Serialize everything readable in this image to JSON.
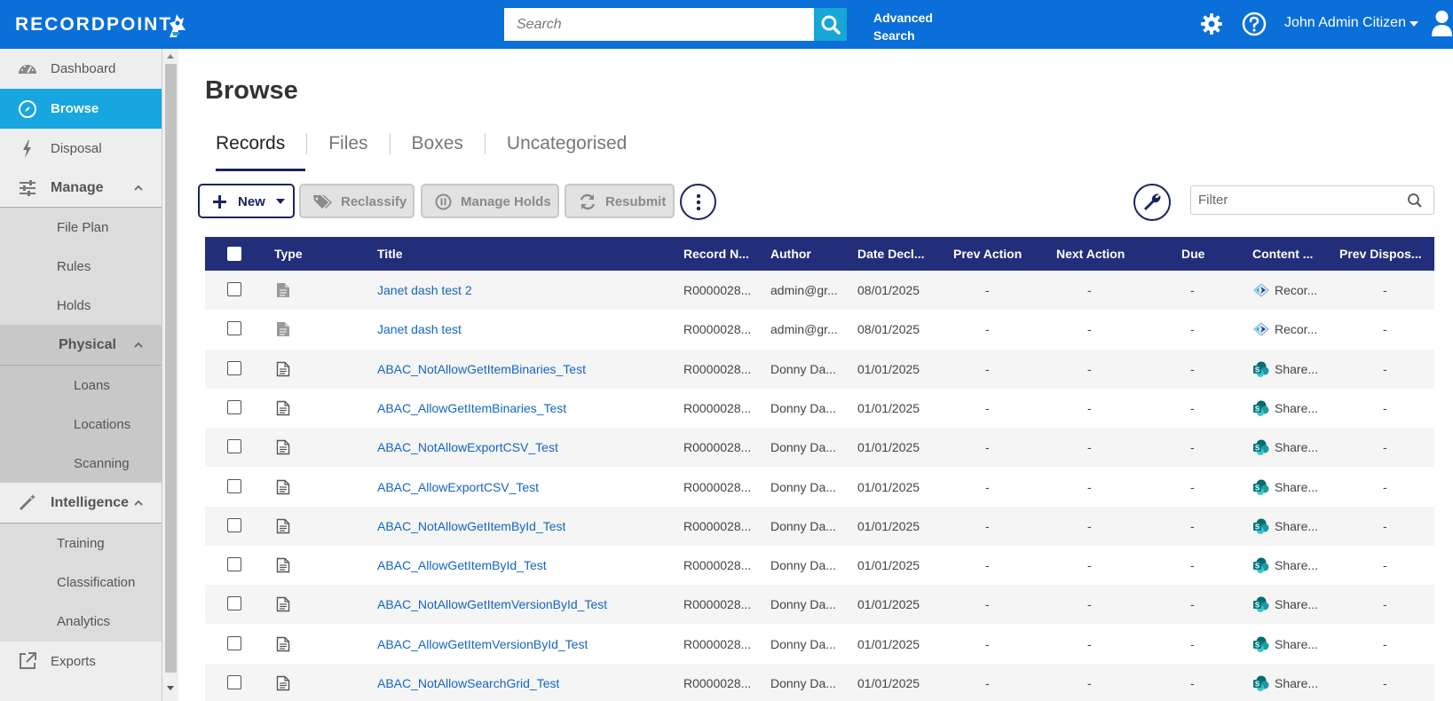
{
  "header": {
    "logo_text": "RECORDPOINT",
    "search_placeholder": "Search",
    "advanced_search_line1": "Advanced",
    "advanced_search_line2": "Search",
    "user_name": "John Admin Citizen"
  },
  "sidebar": {
    "dashboard": "Dashboard",
    "browse": "Browse",
    "disposal": "Disposal",
    "manage": "Manage",
    "file_plan": "File Plan",
    "rules": "Rules",
    "holds": "Holds",
    "physical": "Physical",
    "loans": "Loans",
    "locations": "Locations",
    "scanning": "Scanning",
    "intelligence": "Intelligence",
    "training": "Training",
    "classification": "Classification",
    "analytics": "Analytics",
    "exports": "Exports"
  },
  "main": {
    "title": "Browse",
    "tabs": [
      "Records",
      "Files",
      "Boxes",
      "Uncategorised"
    ],
    "active_tab": "Records",
    "toolbar": {
      "new": "New",
      "reclassify": "Reclassify",
      "manage_holds": "Manage Holds",
      "resubmit": "Resubmit"
    },
    "filter_placeholder": "Filter"
  },
  "table": {
    "columns": [
      "Type",
      "Title",
      "Record N...",
      "Author",
      "Date Decl...",
      "Prev Action",
      "Next Action",
      "Due",
      "Content ...",
      "Prev Dispos..."
    ],
    "rows": [
      {
        "title": "Janet dash test 2",
        "record": "R0000028...",
        "author": "admin@gr...",
        "date": "08/01/2025",
        "prev": "-",
        "next": "-",
        "due": "-",
        "content": "Recor...",
        "content_type": "recordpoint",
        "prevdisp": "-",
        "doc_type": "filled"
      },
      {
        "title": "Janet dash test",
        "record": "R0000028...",
        "author": "admin@gr...",
        "date": "08/01/2025",
        "prev": "-",
        "next": "-",
        "due": "-",
        "content": "Recor...",
        "content_type": "recordpoint",
        "prevdisp": "-",
        "doc_type": "filled"
      },
      {
        "title": "ABAC_NotAllowGetItemBinaries_Test",
        "record": "R0000028...",
        "author": "Donny Da...",
        "date": "01/01/2025",
        "prev": "-",
        "next": "-",
        "due": "-",
        "content": "Share...",
        "content_type": "sharepoint",
        "prevdisp": "-",
        "doc_type": "outline"
      },
      {
        "title": "ABAC_AllowGetItemBinaries_Test",
        "record": "R0000028...",
        "author": "Donny Da...",
        "date": "01/01/2025",
        "prev": "-",
        "next": "-",
        "due": "-",
        "content": "Share...",
        "content_type": "sharepoint",
        "prevdisp": "-",
        "doc_type": "outline"
      },
      {
        "title": "ABAC_NotAllowExportCSV_Test",
        "record": "R0000028...",
        "author": "Donny Da...",
        "date": "01/01/2025",
        "prev": "-",
        "next": "-",
        "due": "-",
        "content": "Share...",
        "content_type": "sharepoint",
        "prevdisp": "-",
        "doc_type": "outline"
      },
      {
        "title": "ABAC_AllowExportCSV_Test",
        "record": "R0000028...",
        "author": "Donny Da...",
        "date": "01/01/2025",
        "prev": "-",
        "next": "-",
        "due": "-",
        "content": "Share...",
        "content_type": "sharepoint",
        "prevdisp": "-",
        "doc_type": "outline"
      },
      {
        "title": "ABAC_NotAllowGetItemById_Test",
        "record": "R0000028...",
        "author": "Donny Da...",
        "date": "01/01/2025",
        "prev": "-",
        "next": "-",
        "due": "-",
        "content": "Share...",
        "content_type": "sharepoint",
        "prevdisp": "-",
        "doc_type": "outline"
      },
      {
        "title": "ABAC_AllowGetItemById_Test",
        "record": "R0000028...",
        "author": "Donny Da...",
        "date": "01/01/2025",
        "prev": "-",
        "next": "-",
        "due": "-",
        "content": "Share...",
        "content_type": "sharepoint",
        "prevdisp": "-",
        "doc_type": "outline"
      },
      {
        "title": "ABAC_NotAllowGetItemVersionById_Test",
        "record": "R0000028...",
        "author": "Donny Da...",
        "date": "01/01/2025",
        "prev": "-",
        "next": "-",
        "due": "-",
        "content": "Share...",
        "content_type": "sharepoint",
        "prevdisp": "-",
        "doc_type": "outline"
      },
      {
        "title": "ABAC_AllowGetItemVersionById_Test",
        "record": "R0000028...",
        "author": "Donny Da...",
        "date": "01/01/2025",
        "prev": "-",
        "next": "-",
        "due": "-",
        "content": "Share...",
        "content_type": "sharepoint",
        "prevdisp": "-",
        "doc_type": "outline"
      },
      {
        "title": "ABAC_NotAllowSearchGrid_Test",
        "record": "R0000028...",
        "author": "Donny Da...",
        "date": "01/01/2025",
        "prev": "-",
        "next": "-",
        "due": "-",
        "content": "Share...",
        "content_type": "sharepoint",
        "prevdisp": "-",
        "doc_type": "outline"
      }
    ]
  },
  "colors": {
    "header_bg": "#0a6fd8",
    "accent": "#17a6e0",
    "table_header": "#222e7a",
    "link": "#1565c0"
  }
}
